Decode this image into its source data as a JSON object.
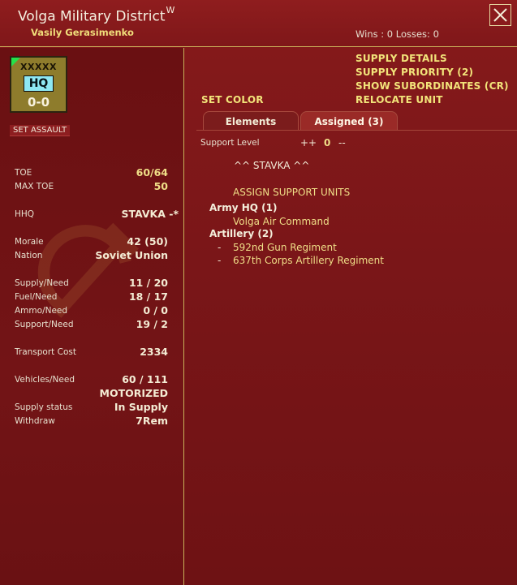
{
  "header": {
    "title": "Volga Military District",
    "title_superscript": "W",
    "commander": "Vasily Gerasimenko",
    "wins_losses": "Wins : 0  Losses: 0"
  },
  "unit_counter": {
    "size": "XXXXX",
    "type": "HQ",
    "strength": "0-0",
    "colors": {
      "counter": "#8e7c2c",
      "type_box": "#8ee7f2",
      "corner_flag": "#24e24a"
    }
  },
  "left": {
    "set_assault": "SET ASSAULT",
    "stats": [
      {
        "label": "TOE",
        "value": "60/64"
      },
      {
        "label": "MAX TOE",
        "value": "50"
      },
      {
        "label": "HHQ",
        "value": "STAVKA -*"
      },
      {
        "label": "Morale",
        "value": "42 (50)"
      },
      {
        "label": "Nation",
        "value": "Soviet Union"
      },
      {
        "label": "Supply/Need",
        "value": "11 / 20"
      },
      {
        "label": "Fuel/Need",
        "value": "18 / 17"
      },
      {
        "label": "Ammo/Need",
        "value": "0 / 0"
      },
      {
        "label": "Support/Need",
        "value": "19 / 2"
      },
      {
        "label": "Transport Cost",
        "value": "2334"
      },
      {
        "label": "Vehicles/Need",
        "value": "60 / 111"
      },
      {
        "label": "",
        "value": "MOTORIZED"
      },
      {
        "label": "Supply status",
        "value": "In Supply"
      },
      {
        "label": "Withdraw",
        "value": "7Rem"
      }
    ]
  },
  "right": {
    "links": {
      "supply_details": "SUPPLY DETAILS",
      "supply_priority": "SUPPLY PRIORITY (2)",
      "show_subordinates": "SHOW SUBORDINATES (CR)",
      "relocate_unit": "RELOCATE UNIT",
      "set_color": "SET COLOR"
    },
    "tabs": [
      {
        "label": "Elements",
        "active": false
      },
      {
        "label": "Assigned (3)",
        "active": true
      }
    ],
    "support_level": {
      "label": "Support Level",
      "increase": "++",
      "value": "0",
      "decrease": "--"
    },
    "hq_line": "^^  STAVKA  ^^",
    "assign_support": "ASSIGN SUPPORT UNITS",
    "groups": [
      {
        "header": "Army HQ (1)",
        "units": [
          {
            "dash": "",
            "name": "Volga Air Command"
          }
        ]
      },
      {
        "header": "Artillery (2)",
        "units": [
          {
            "dash": "-",
            "name": "592nd Gun Regiment"
          },
          {
            "dash": "-",
            "name": "637th Corps Artillery Regiment"
          }
        ]
      }
    ]
  },
  "icons": {
    "close": "close-icon",
    "emblem": "hammer-sickle-icon"
  }
}
